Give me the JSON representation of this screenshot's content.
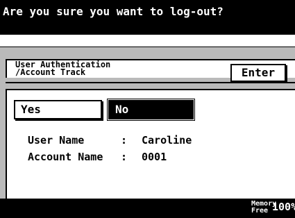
{
  "header": {
    "prompt": "Are you sure you want to log-out?"
  },
  "tab": {
    "line1": "User Authentication",
    "line2": "/Account Track",
    "enter_label": "Enter"
  },
  "choices": {
    "yes_label": "Yes",
    "no_label": "No",
    "selected": "No"
  },
  "info": [
    {
      "label": "User Name",
      "sep": ":",
      "value": "Caroline"
    },
    {
      "label": "Account Name",
      "sep": ":",
      "value": "0001"
    }
  ],
  "status": {
    "memory_label_line1": "Memory",
    "memory_label_line2": "Free",
    "memory_value": "100%"
  }
}
